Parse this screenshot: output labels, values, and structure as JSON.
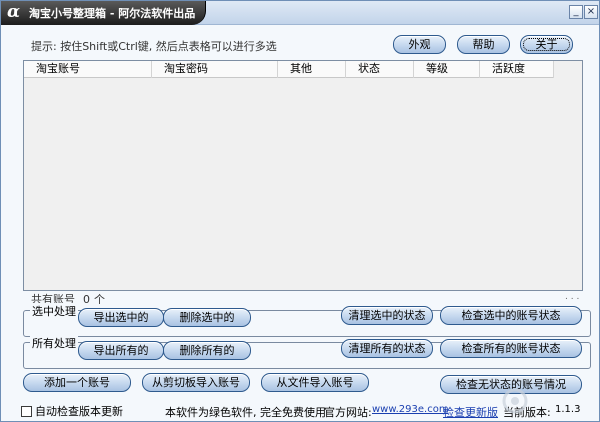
{
  "window": {
    "title": "淘宝小号整理箱 - 阿尔法软件出品",
    "logo_glyph": "α",
    "minimize_glyph": "_",
    "close_glyph": "×"
  },
  "hint": "提示: 按住Shift或Ctrl键, 然后点表格可以进行多选",
  "top_buttons": {
    "appearance": "外观",
    "help": "帮助",
    "about": "关于"
  },
  "table": {
    "columns": [
      "淘宝账号",
      "淘宝密码",
      "其他",
      "状态",
      "等级",
      "活跃度"
    ],
    "rows": []
  },
  "count": {
    "label": "共有账号",
    "value": "0",
    "unit": "个"
  },
  "selected_group": {
    "label": "选中处理",
    "export": "导出选中的",
    "delete": "删除选中的",
    "clear_status": "清理选中的状态",
    "check_status": "检查选中的账号状态"
  },
  "all_group": {
    "label": "所有处理",
    "export": "导出所有的",
    "delete": "删除所有的",
    "clear_status": "清理所有的状态",
    "check_status": "检查所有的账号状态"
  },
  "import_buttons": {
    "add_one": "添加一个账号",
    "from_clipboard": "从剪切板导入账号",
    "from_file": "从文件导入账号",
    "check_no_status": "检查无状态的账号情况"
  },
  "footer": {
    "auto_check": "自动检查版本更新",
    "free_text": "本软件为绿色软件, 完全免费使用",
    "website_label": "官方网站:",
    "website": "www.293e.com",
    "check_update": "检查更新版",
    "version_label": "当前版本:",
    "version": "1.1.3"
  },
  "colors": {
    "accent": "#2e5a8e",
    "title_dark": "#1c1c1c",
    "link": "#1a3fb0"
  }
}
